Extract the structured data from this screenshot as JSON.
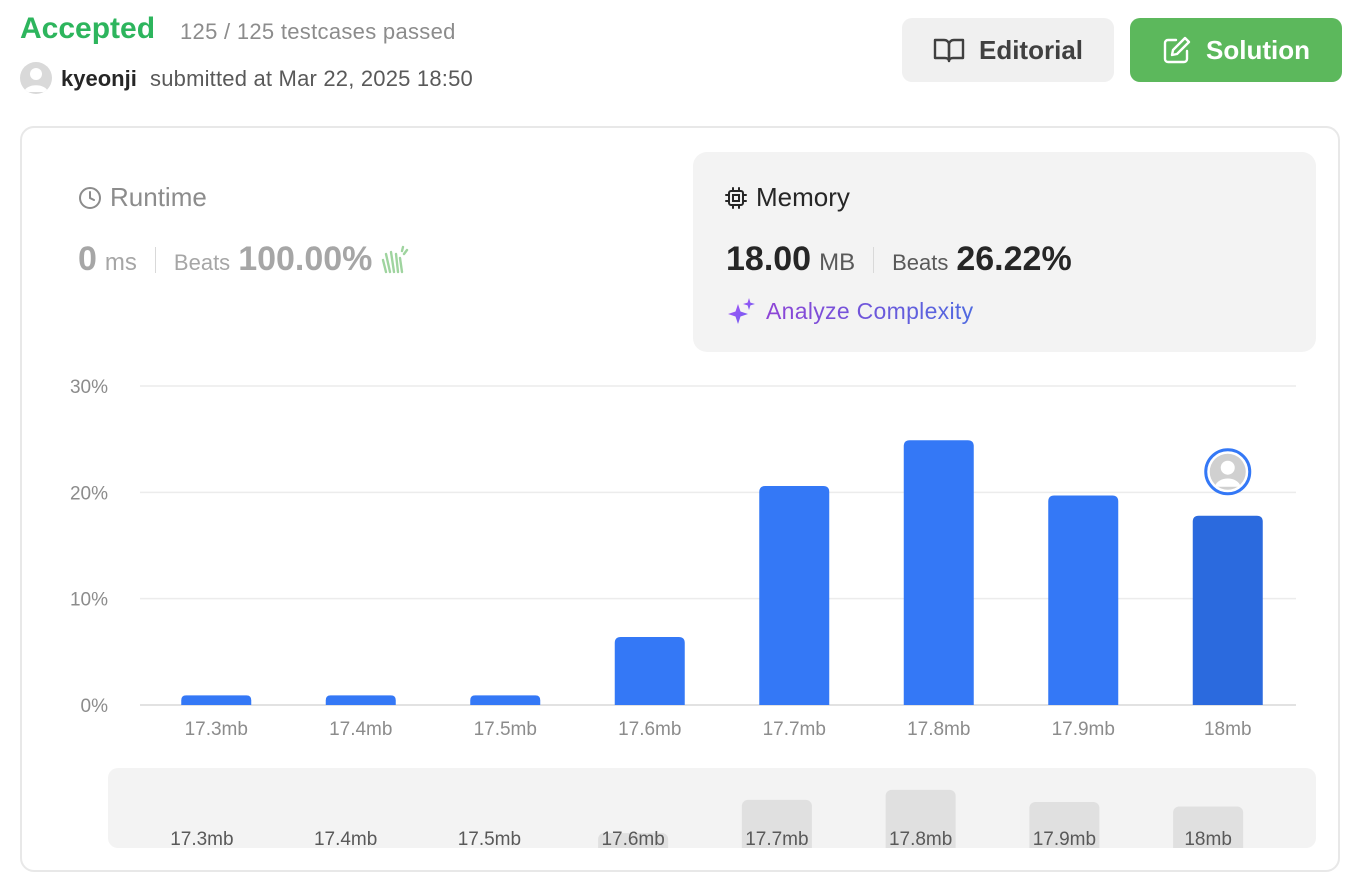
{
  "header": {
    "status": "Accepted",
    "testcases": "125 / 125 testcases passed",
    "username": "kyeonji",
    "submitted": "submitted at Mar 22, 2025 18:50",
    "editorial_label": "Editorial",
    "solution_label": "Solution"
  },
  "runtime": {
    "title": "Runtime",
    "value": "0",
    "unit": "ms",
    "beats_label": "Beats",
    "beats_value": "100.00%"
  },
  "memory": {
    "title": "Memory",
    "value": "18.00",
    "unit": "MB",
    "beats_label": "Beats",
    "beats_value": "26.22%",
    "analyze_label": "Analyze Complexity"
  },
  "colors": {
    "accepted": "#2db55d",
    "bar": "#3478f6",
    "bar_selected": "#2b6ade",
    "solution_button": "#5cb85c",
    "slider_bar": "#e0e0e0"
  },
  "chart_data": {
    "type": "bar",
    "categories": [
      "17.3mb",
      "17.4mb",
      "17.5mb",
      "17.6mb",
      "17.7mb",
      "17.8mb",
      "17.9mb",
      "18mb"
    ],
    "values": [
      0.9,
      0.9,
      0.9,
      6.4,
      20.6,
      24.9,
      19.7,
      17.8
    ],
    "y_ticks": [
      "0%",
      "10%",
      "20%",
      "30%"
    ],
    "ylim": [
      0,
      30
    ],
    "selected_category": "18mb",
    "grid": true
  },
  "slider": {
    "labels": [
      "17.3mb",
      "17.4mb",
      "17.5mb",
      "17.6mb",
      "17.7mb",
      "17.8mb",
      "17.9mb",
      "18mb"
    ]
  }
}
